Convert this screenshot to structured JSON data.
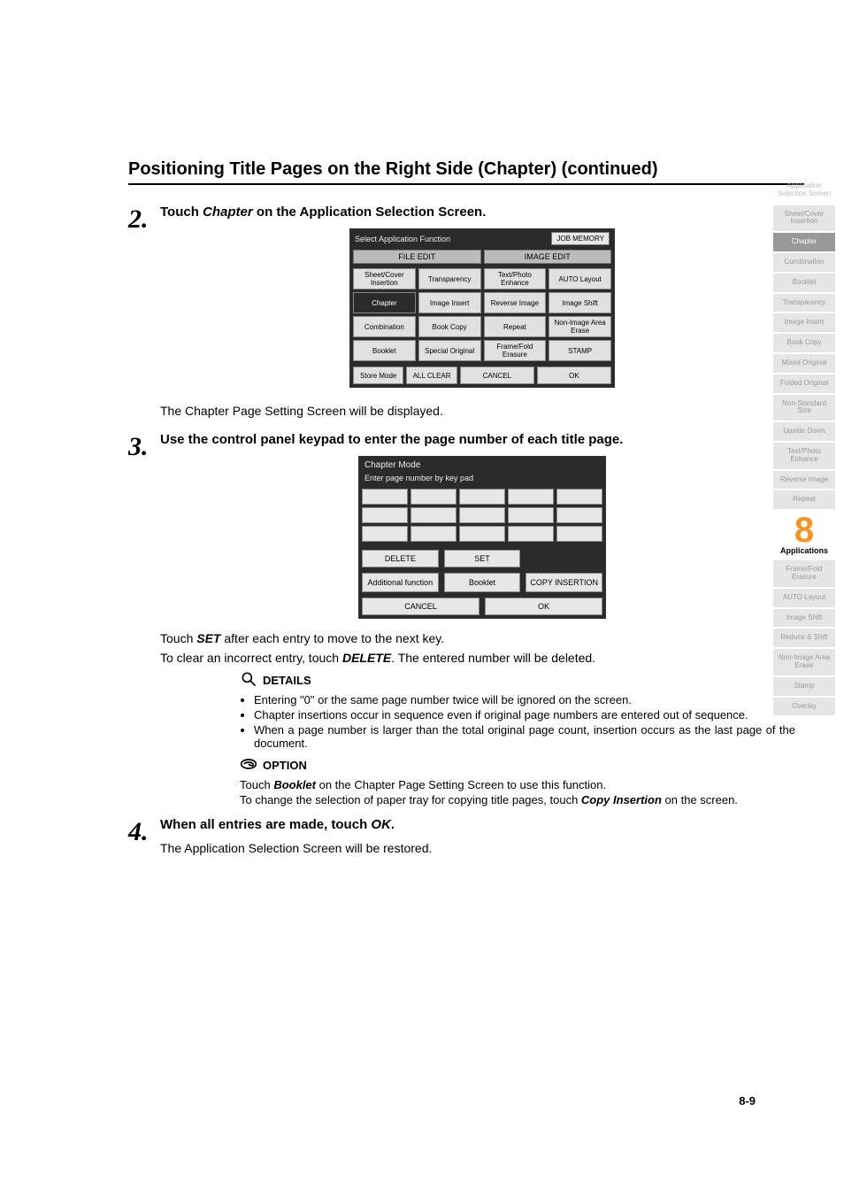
{
  "heading": "Positioning Title Pages on the Right Side (Chapter) (continued)",
  "steps": {
    "s2": {
      "num": "2.",
      "lead_a": "Touch ",
      "lead_b": "Chapter",
      "lead_c": " on the Application Selection Screen.",
      "after": "The Chapter Page Setting Screen will be displayed."
    },
    "s3": {
      "num": "3.",
      "lead": "Use the control panel keypad to enter the page number of each title page.",
      "after_a": "Touch ",
      "after_b": "SET",
      "after_c": " after each entry to move to the next key.",
      "after2_a": "To clear an incorrect entry, touch ",
      "after2_b": "DELETE",
      "after2_c": ". The entered number will be deleted."
    },
    "s4": {
      "num": "4.",
      "lead_a": "When all entries are made, touch ",
      "lead_b": "OK",
      "lead_c": ".",
      "after": "The Application Selection Screen will be restored."
    }
  },
  "details": {
    "title": "DETAILS",
    "items": [
      "Entering \"0\" or the same page number twice will be ignored on the screen.",
      "Chapter insertions occur in sequence even if original page numbers are entered out of sequence.",
      "When a page number is larger than the total original page count, insertion occurs as the last page of the document."
    ]
  },
  "option": {
    "title": "OPTION",
    "p1_a": "Touch ",
    "p1_b": "Booklet",
    "p1_c": " on the Chapter Page Setting Screen to use this function.",
    "p2_a": "To change the selection of paper tray for copying title pages, touch ",
    "p2_b": "Copy Insertion",
    "p2_c": " on the screen."
  },
  "app_screen": {
    "title": "Select Application Function",
    "job_memory": "JOB MEMORY",
    "file_edit": "FILE EDIT",
    "image_edit": "IMAGE EDIT",
    "buttons": [
      "Sheet/Cover Insertion",
      "Transparency",
      "Text/Photo Enhance",
      "AUTO Layout",
      "Chapter",
      "Image Insert",
      "Reverse Image",
      "Image Shift",
      "Combination",
      "Book Copy",
      "Repeat",
      "Non-Image Area Erase",
      "Booklet",
      "Special Original",
      "Frame/Fold Erasure",
      "STAMP"
    ],
    "bottom": {
      "store": "Store Mode",
      "clear": "ALL CLEAR",
      "cancel": "CANCEL",
      "ok": "OK"
    }
  },
  "ch_screen": {
    "title": "Chapter Mode",
    "sub": "Enter page number by key pad",
    "delete": "DELETE",
    "set": "SET",
    "addl": "Additional function",
    "booklet": "Booklet",
    "copyins": "COPY INSERTION",
    "cancel": "CANCEL",
    "ok": "OK"
  },
  "sidebar": [
    {
      "label": "Application Selection Screen",
      "type": "plain"
    },
    {
      "label": "Sheet/Cover Insertion",
      "type": "boxed"
    },
    {
      "label": "Chapter",
      "type": "active"
    },
    {
      "label": "Combination",
      "type": "boxed"
    },
    {
      "label": "Booklet",
      "type": "boxed"
    },
    {
      "label": "Transparency",
      "type": "boxed"
    },
    {
      "label": "Image Insert",
      "type": "boxed"
    },
    {
      "label": "Book Copy",
      "type": "boxed"
    },
    {
      "label": "Mixed Original",
      "type": "boxed"
    },
    {
      "label": "Folded Original",
      "type": "boxed"
    },
    {
      "label": "Non-Standard Size",
      "type": "boxed"
    },
    {
      "label": "Upside Down",
      "type": "boxed"
    },
    {
      "label": "Text/Photo Enhance",
      "type": "boxed"
    },
    {
      "label": "Reverse Image",
      "type": "boxed"
    },
    {
      "label": "Repeat",
      "type": "boxed"
    }
  ],
  "big8": {
    "num": "8",
    "label": "Applications"
  },
  "sidebar2": [
    {
      "label": "Frame/Fold Erasure",
      "type": "boxed"
    },
    {
      "label": "AUTO Layout",
      "type": "boxed"
    },
    {
      "label": "Image Shift",
      "type": "boxed"
    },
    {
      "label": "Reduce & Shift",
      "type": "boxed"
    },
    {
      "label": "Non-Image Area Erase",
      "type": "boxed"
    },
    {
      "label": "Stamp",
      "type": "boxed"
    },
    {
      "label": "Overlay",
      "type": "boxed"
    }
  ],
  "page_number": "8-9"
}
